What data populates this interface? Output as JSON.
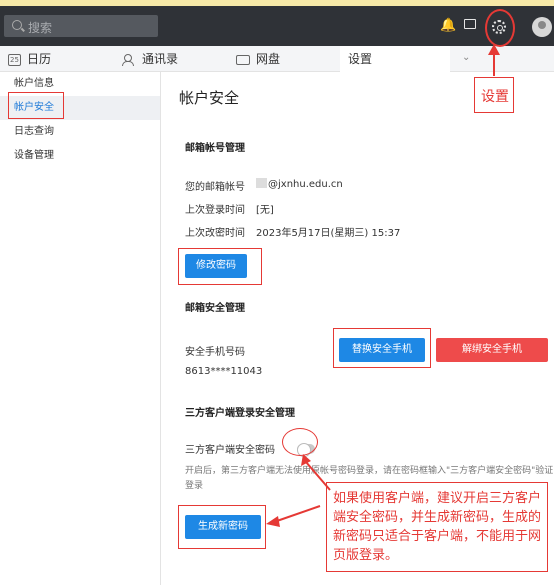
{
  "topbar": {
    "search_placeholder": "搜索",
    "icons": [
      "bell-icon",
      "window-icon",
      "gear-icon",
      "avatar"
    ]
  },
  "tabs": [
    {
      "label": "日历",
      "icon": "calendar-icon",
      "icon_text": "25"
    },
    {
      "label": "通讯录",
      "icon": "contacts-icon"
    },
    {
      "label": "网盘",
      "icon": "disk-icon"
    },
    {
      "label": "设置",
      "active": true
    }
  ],
  "sidebar": {
    "items": [
      {
        "label": "帐户信息"
      },
      {
        "label": "帐户安全",
        "active": true
      },
      {
        "label": "日志查询"
      },
      {
        "label": "设备管理"
      }
    ]
  },
  "main": {
    "title": "帐户安全",
    "mail_section": {
      "heading": "邮箱帐号管理",
      "account_label": "您的邮箱帐号",
      "account_value": "@jxnhu.edu.cn",
      "last_login_label": "上次登录时间",
      "last_login_value": "[无]",
      "last_pwd_label": "上次改密时间",
      "last_pwd_value": "2023年5月17日(星期三) 15:37",
      "change_pwd_button": "修改密码"
    },
    "phone_section": {
      "heading": "邮箱安全管理",
      "phone_label": "安全手机号码",
      "phone_value": "8613****11043",
      "replace_button": "替换安全手机",
      "unbind_button": "解绑安全手机"
    },
    "third_party_section": {
      "heading": "三方客户端登录安全管理",
      "pwd_label": "三方客户端安全密码",
      "toggle_on": false,
      "hint": "开启后，第三方客户端无法使用原帐号密码登录，请在密码框输入\"三方客户端安全密码\"验证登录",
      "generate_button": "生成新密码"
    }
  },
  "annotations": {
    "settings_note": "设置",
    "client_note": "如果使用客户端，建议开启三方客户端安全密码，并生成新密码，生成的新密码只适合于客户端，不能用于网页版登录。",
    "color": "#e53935"
  },
  "colors": {
    "topbar": "#2f3237",
    "primary": "#1e88e5",
    "danger": "#ee4b4b",
    "sidebar_active_text": "#1e7ad8"
  }
}
